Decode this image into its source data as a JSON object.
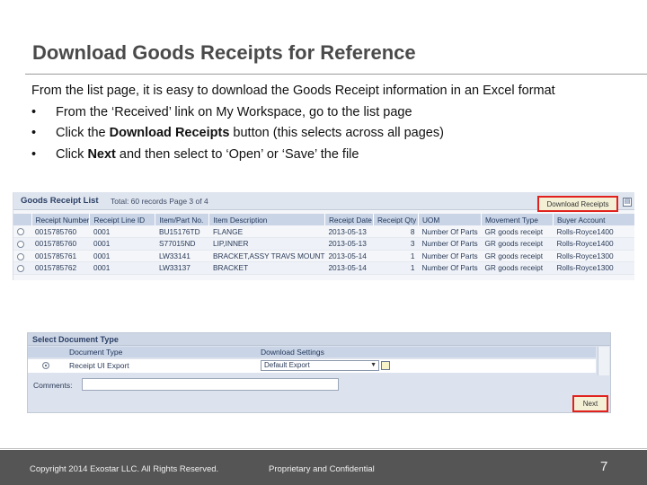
{
  "slide": {
    "title": "Download Goods Receipts for Reference",
    "intro": "From the list page, it is easy to download the Goods Receipt information in an Excel format",
    "bullets": [
      {
        "symbol": "•",
        "before": "From the ‘Received’ link on My Workspace, go to the list page",
        "strong": "",
        "after": ""
      },
      {
        "symbol": "•",
        "before": "Click the ",
        "strong": "Download Receipts",
        "after": " button (this selects across all pages)"
      },
      {
        "symbol": "•",
        "before": "Click ",
        "strong": "Next",
        "after": " and then select to ‘Open’ or ‘Save’ the file"
      }
    ]
  },
  "goods_receipt_list": {
    "title": "Goods Receipt List",
    "subtitle": "Total: 60 records Page 3 of 4",
    "download_button": "Download Receipts",
    "columns": [
      "Receipt Number",
      "Receipt Line ID",
      "Item/Part No.",
      "Item Description",
      "Receipt Date",
      "Receipt Qty",
      "UOM",
      "Movement Type",
      "Buyer Account"
    ],
    "rows": [
      [
        "0015785760",
        "0001",
        "BU15176TD",
        "FLANGE",
        "2013-05-13",
        "8",
        "Number Of Parts",
        "GR goods receipt",
        "Rolls-Royce1400"
      ],
      [
        "0015785760",
        "0001",
        "S77015ND",
        "LIP,INNER",
        "2013-05-13",
        "3",
        "Number Of Parts",
        "GR goods receipt",
        "Rolls-Royce1400"
      ],
      [
        "0015785761",
        "0001",
        "LW33141",
        "BRACKET,ASSY TRAVS MOUNT",
        "2013-05-14",
        "1",
        "Number Of Parts",
        "GR goods receipt",
        "Rolls-Royce1300"
      ],
      [
        "0015785762",
        "0001",
        "LW33137",
        "BRACKET",
        "2013-05-14",
        "1",
        "Number Of Parts",
        "GR goods receipt",
        "Rolls-Royce1300"
      ]
    ]
  },
  "select_document_type": {
    "title": "Select Document Type",
    "col_document_type": "Document Type",
    "col_download_settings": "Download Settings",
    "row_document_type": "Receipt UI Export",
    "row_setting_value": "Default Export",
    "comments_label": "Comments:",
    "next_button": "Next"
  },
  "footer": {
    "copyright": "Copyright 2014 Exostar LLC. All Rights Reserved.",
    "confidential": "Proprietary and Confidential",
    "page_number": "7"
  },
  "colors": {
    "highlight": "#e0211d",
    "footer_bg": "#555555",
    "grid_header": "#c9d4e6"
  }
}
